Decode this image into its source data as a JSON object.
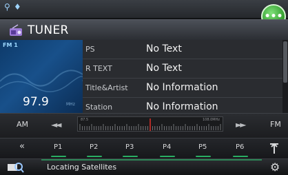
{
  "status_bar": {
    "icons": [
      "antenna-icon",
      "signal-icon"
    ],
    "chat_icon": "chat-bubble-icon"
  },
  "header": {
    "title": "TUNER",
    "icon": "tuner-icon"
  },
  "station": {
    "band": "FM 1",
    "frequency": "97.9",
    "unit": "MHz"
  },
  "info_rows": [
    {
      "label": "PS",
      "value": "No Text"
    },
    {
      "label": "R TEXT",
      "value": "No Text"
    },
    {
      "label": "Title&Artist",
      "value": "No Information"
    },
    {
      "label": "Station",
      "value": "No Information"
    }
  ],
  "tuning": {
    "am_label": "AM",
    "fm_label": "FM",
    "seek_down": "◄◄",
    "seek_up": "►►",
    "scale_low": "87.5",
    "scale_high": "108.0MHz",
    "needle_fraction": 0.5
  },
  "presets": {
    "prev_label": "«",
    "items": [
      "P1",
      "P2",
      "P3",
      "P4",
      "P5",
      "P6"
    ],
    "tune_icon": "antenna-tune-icon"
  },
  "footer": {
    "status": "Locating Satellites",
    "search_icon": "search-icon",
    "settings_icon": "gear-icon"
  },
  "colors": {
    "accent_green": "#2fe07b",
    "needle_red": "#e0302a",
    "panel_blue": "#18508a"
  }
}
